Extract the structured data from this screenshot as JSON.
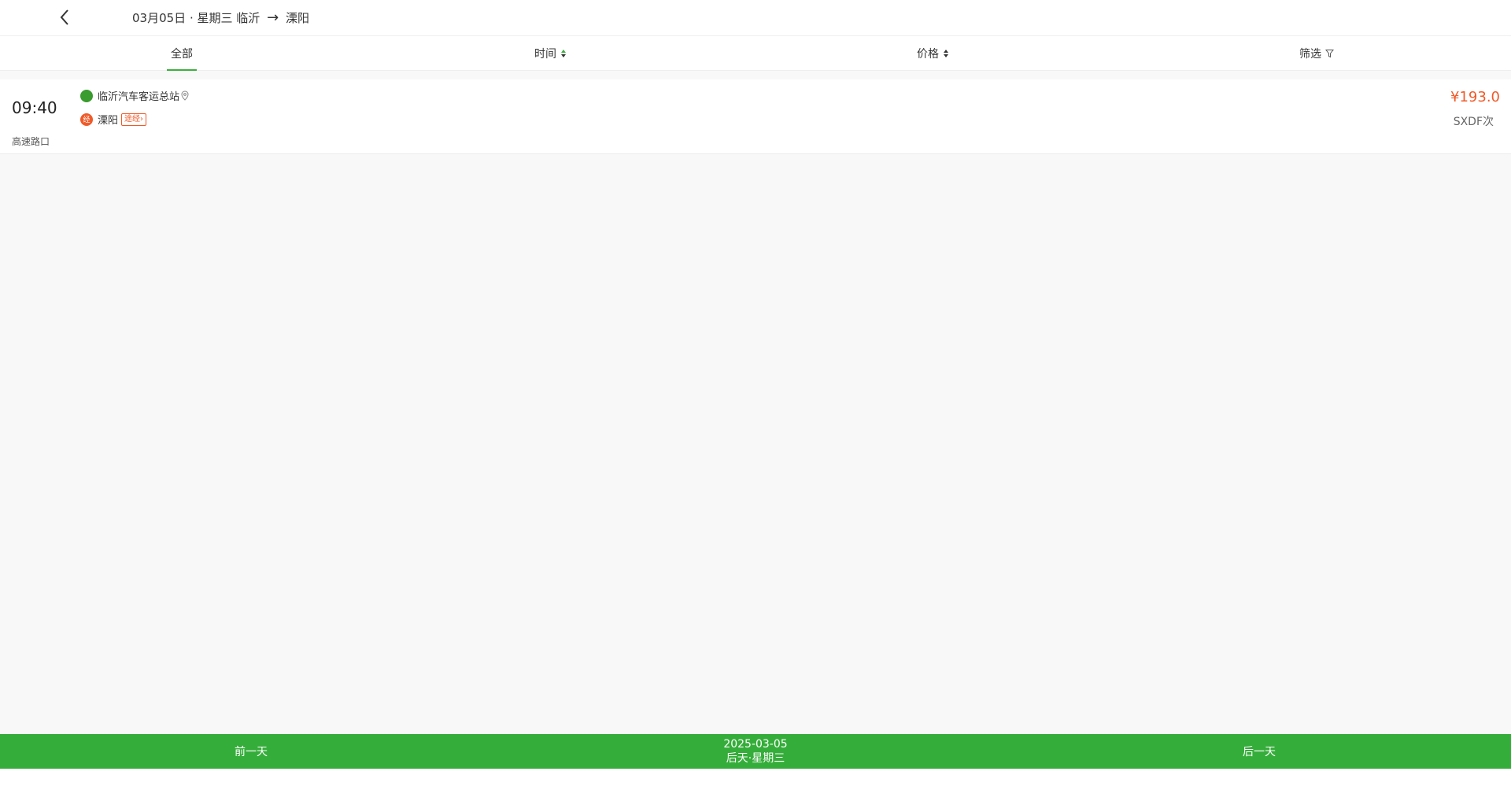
{
  "header": {
    "date": "03月05日 · 星期三",
    "origin": "临沂",
    "arrow": "→",
    "destination": "溧阳"
  },
  "tabs": {
    "all": "全部",
    "time": "时间",
    "price": "价格",
    "filter": "筛选"
  },
  "trips": [
    {
      "time": "09:40",
      "note": "高速路口",
      "from_station": "临沂汽车客运总站",
      "to_station": "溧阳",
      "via_marker": "经",
      "via_label": "途经",
      "price": "¥193.0",
      "bus_code": "SXDF次"
    }
  ],
  "bottom": {
    "prev_day": "前一天",
    "current_date": "2025-03-05",
    "current_day": "后天·星期三",
    "next_day": "后一天"
  },
  "colors": {
    "accent_green": "#35ad3a",
    "price_red": "#f05a28",
    "station_green": "#3a9b2e"
  }
}
